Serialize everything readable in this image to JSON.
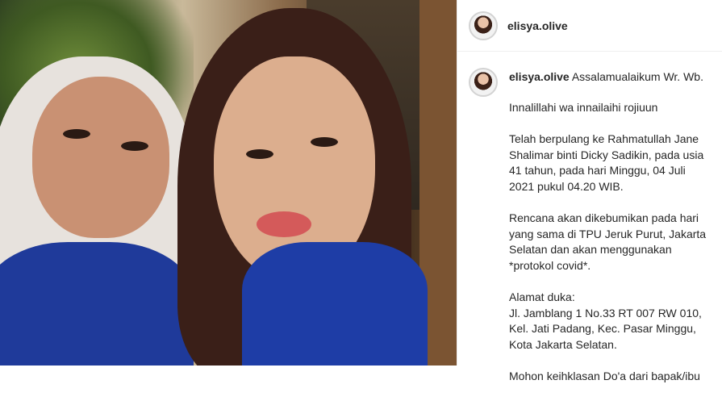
{
  "post": {
    "username": "elisya.olive",
    "avatar_icon": "profile-avatar"
  },
  "caption": {
    "username": "elisya.olive",
    "greeting": "Assalamualaikum Wr. Wb.",
    "paragraphs": [
      "Innalillahi wa innailaihi rojiuun",
      "Telah berpulang ke Rahmatullah Jane Shalimar binti Dicky Sadikin, pada usia 41 tahun, pada hari Minggu, 04 Juli 2021 pukul 04.20 WIB.",
      "Rencana akan dikebumikan pada hari yang sama di TPU Jeruk Purut, Jakarta Selatan dan akan menggunakan *protokol covid*.",
      "Alamat duka:\nJl. Jamblang 1 No.33 RT 007 RW 010, Kel. Jati Padang, Kec. Pasar Minggu, Kota Jakarta Selatan.",
      "Mohon keihklasan Do'a dari bapak/ibu"
    ]
  }
}
